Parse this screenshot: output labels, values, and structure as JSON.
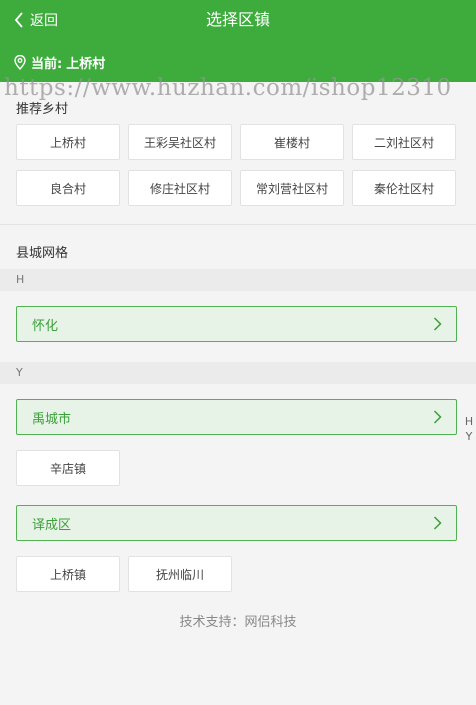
{
  "header": {
    "back_label": "返回",
    "title": "选择区镇",
    "current_prefix": "当前:",
    "current_value": "上桥村",
    "bg_color": "#3dac3d"
  },
  "watermark": "https://www.huzhan.com/ishop12310",
  "recommended": {
    "title": "推荐乡村",
    "items": [
      "上桥村",
      "王彩吴社区村",
      "崔楼村",
      "二刘社区村",
      "良合村",
      "修庄社区村",
      "常刘营社区村",
      "秦伦社区村"
    ]
  },
  "county": {
    "title": "县城网格",
    "groups": [
      {
        "letter": "H",
        "cities": [
          {
            "name": "怀化",
            "towns": []
          }
        ]
      },
      {
        "letter": "Y",
        "cities": [
          {
            "name": "禹城市",
            "towns": [
              "辛店镇"
            ]
          },
          {
            "name": "译成区",
            "towns": [
              "上桥镇",
              "抚州临川"
            ]
          }
        ]
      }
    ]
  },
  "index_letters": [
    "H",
    "Y"
  ],
  "footer": "技术支持：网侣科技",
  "accent_color": "#3aa03a"
}
